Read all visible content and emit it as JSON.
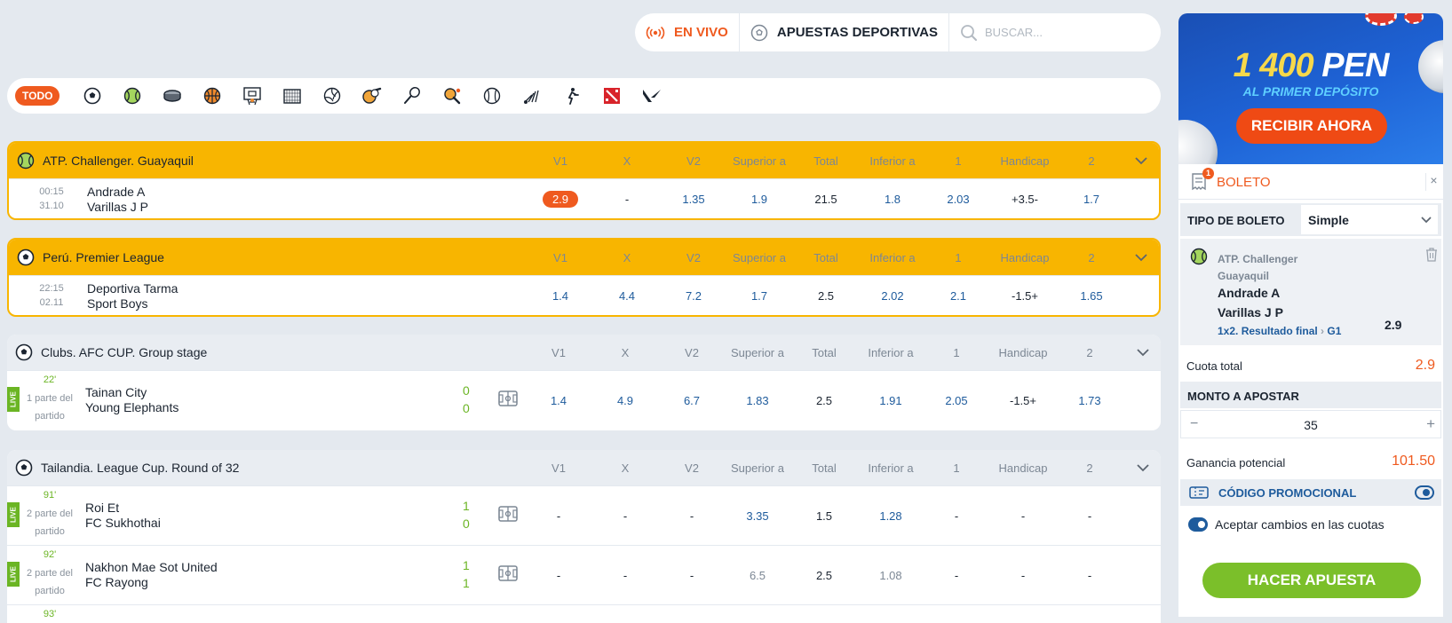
{
  "topnav": {
    "live": "EN VIVO",
    "sports": "APUESTAS DEPORTIVAS",
    "search_placeholder": "BUSCAR..."
  },
  "sports_filter": {
    "all": "TODO",
    "icons": [
      "soccer-icon",
      "tennis-icon",
      "hockey-icon",
      "basketball-icon",
      "basketball-hoop-icon",
      "futsal-icon",
      "volleyball-icon",
      "baseball-icon",
      "badminton-icon",
      "table-tennis-icon",
      "handball-icon",
      "shuttlecock-icon",
      "counter-strike-icon",
      "dota-icon",
      "valorant-icon"
    ]
  },
  "columns": [
    "V1",
    "X",
    "V2",
    "Superior a",
    "Total",
    "Inferior a",
    "1",
    "Handicap",
    "2"
  ],
  "leagues": [
    {
      "title": "ATP. Challenger. Guayaquil",
      "sport": "tennis-icon",
      "rows": [
        {
          "time": "00:15",
          "date": "31.10",
          "home": "Andrade A",
          "away": "Varillas J P",
          "odds": [
            "2.9",
            "-",
            "1.35",
            "1.9",
            "21.5",
            "1.8",
            "2.03",
            "+3.5-",
            "1.7"
          ]
        }
      ]
    },
    {
      "title": "Perú. Premier League",
      "sport": "soccer-icon",
      "rows": [
        {
          "time": "22:15",
          "date": "02.11",
          "home": "Deportiva Tarma",
          "away": "Sport Boys",
          "odds": [
            "1.4",
            "4.4",
            "7.2",
            "1.7",
            "2.5",
            "2.02",
            "2.1",
            "-1.5+",
            "1.65"
          ]
        }
      ]
    },
    {
      "title": "Clubs. AFC CUP. Group stage",
      "sport": "soccer-icon",
      "rows": [
        {
          "live": "LIVE",
          "minute": "22'",
          "period": "1 parte del partido",
          "home": "Tainan City",
          "away": "Young Elephants",
          "score_home": "0",
          "score_away": "0",
          "odds": [
            "1.4",
            "4.9",
            "6.7",
            "1.83",
            "2.5",
            "1.91",
            "2.05",
            "-1.5+",
            "1.73"
          ]
        }
      ]
    },
    {
      "title": "Tailandia. League Cup. Round of 32",
      "sport": "soccer-icon",
      "rows": [
        {
          "live": "LIVE",
          "minute": "91'",
          "period": "2 parte del partido",
          "home": "Roi Et",
          "away": "FC Sukhothai",
          "score_home": "1",
          "score_away": "0",
          "odds": [
            "-",
            "-",
            "-",
            "3.35",
            "1.5",
            "1.28",
            "-",
            "-",
            "-"
          ]
        },
        {
          "live": "LIVE",
          "minute": "92'",
          "period": "2 parte del partido",
          "home": "Nakhon Mae Sot United",
          "away": "FC Rayong",
          "score_home": "1",
          "score_away": "1",
          "odds": [
            "-",
            "-",
            "-",
            "6.5",
            "2.5",
            "1.08",
            "-",
            "-",
            "-"
          ]
        },
        {
          "minute": "93'"
        }
      ]
    }
  ],
  "promo": {
    "amount": "1 400",
    "currency": "PEN",
    "subtitle": "AL PRIMER DEPÓSITO",
    "button": "RECIBIR AHORA"
  },
  "betslip": {
    "title": "BOLETO",
    "count": "1",
    "close": "×",
    "type_label": "TIPO DE BOLETO",
    "type_value": "Simple",
    "bet": {
      "league": "ATP. Challenger Guayaquil",
      "home": "Andrade A",
      "away": "Varillas J P",
      "market": "1x2. Resultado final",
      "selection": "G1",
      "odd": "2.9"
    },
    "total_label": "Cuota total",
    "total_value": "2.9",
    "amount_label": "MONTO A APOSTAR",
    "amount_value": "35",
    "minus": "−",
    "plus": "+",
    "potential_label": "Ganancia potencial",
    "potential_value": "101.50",
    "promo_code": "CÓDIGO PROMOCIONAL",
    "accept_label": "Aceptar cambios en las cuotas",
    "place_bet": "HACER APUESTA"
  },
  "colors": {
    "accent": "#ef5a1f",
    "highlight": "#f8b500",
    "odds_blue": "#1e5b9c",
    "live_green": "#6bb524",
    "cta_green": "#7bbf2a"
  }
}
